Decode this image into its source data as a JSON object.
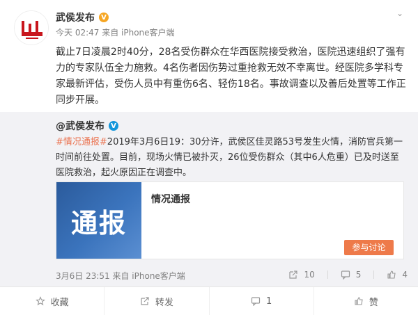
{
  "post": {
    "username": "武侯发布",
    "meta": "今天 02:47 来自 iPhone客户端",
    "text": "截止7日凌晨2时40分，28名受伤群众在华西医院接受救治，医院迅速组织了强有力的专家队伍全力施救。4名伤者因伤势过重抢救无效不幸离世。经医院多学科专家最新评估，受伤人员中有重伤6名、轻伤18名。事故调查以及善后处置等工作正同步开展。"
  },
  "retweet": {
    "username": "@武侯发布",
    "hashtag": "#情况通报#",
    "text": "2019年3月6日19：30分许，武侯区佳灵路53号发生火情，消防官兵第一时间前往处置。目前，现场火情已被扑灭，26位受伤群众（其中6人危重）已及时送至医院救治，起火原因正在调查中。",
    "card": {
      "image_text": "通报",
      "title": "情况通报",
      "button": "参与讨论"
    },
    "footer": {
      "time": "3月6日 23:51 来自 iPhone客户端",
      "reposts": "10",
      "comments": "5",
      "likes": "4"
    }
  },
  "actions": {
    "collect": "收藏",
    "repost": "转发",
    "comment": "1",
    "like": "赞"
  },
  "colors": {
    "accent": "#eb7350",
    "retweet_bg": "#f2f2f5",
    "verified": "#f6a623"
  }
}
